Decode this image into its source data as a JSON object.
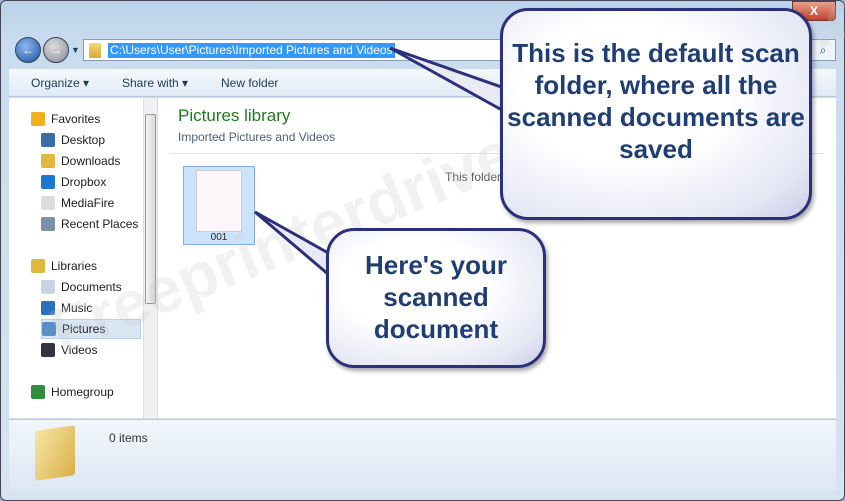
{
  "window": {
    "close_label": "X"
  },
  "address": {
    "path": "C:\\Users\\User\\Pictures\\Imported Pictures and Videos"
  },
  "toolbar": {
    "organize": "Organize ▾",
    "share": "Share with ▾",
    "new_folder": "New folder"
  },
  "sidebar": {
    "items": [
      {
        "label": "Favorites",
        "icon": "star-icon",
        "color": "#f0b020"
      },
      {
        "label": "Desktop",
        "icon": "desktop-icon",
        "color": "#3a6ea5"
      },
      {
        "label": "Downloads",
        "icon": "folder-icon",
        "color": "#e0b840"
      },
      {
        "label": "Dropbox",
        "icon": "dropbox-icon",
        "color": "#1f77d0"
      },
      {
        "label": "MediaFire",
        "icon": "file-icon",
        "color": "#dddddd"
      },
      {
        "label": "Recent Places",
        "icon": "recent-places-icon",
        "color": "#7a8fa8"
      },
      {
        "label": "Libraries",
        "icon": "libraries-icon",
        "color": "#e0b840"
      },
      {
        "label": "Documents",
        "icon": "documents-icon",
        "color": "#c8d4e4"
      },
      {
        "label": "Music",
        "icon": "music-icon",
        "color": "#2a6fc0"
      },
      {
        "label": "Pictures",
        "icon": "pictures-icon",
        "color": "#5b8fc8"
      },
      {
        "label": "Videos",
        "icon": "videos-icon",
        "color": "#333344"
      },
      {
        "label": "Homegroup",
        "icon": "homegroup-icon",
        "color": "#2f8f3f"
      }
    ]
  },
  "main": {
    "title": "Pictures library",
    "subtitle": "Imported Pictures and Videos",
    "empty_text": "This folder",
    "file": {
      "name": "001"
    }
  },
  "status": {
    "items": "0 items"
  },
  "callouts": {
    "scan_folder": "This is the default scan folder, where all the scanned documents are saved",
    "scanned_doc": "Here's your scanned document"
  },
  "watermark": "Freeprinterdriverdownload.org"
}
